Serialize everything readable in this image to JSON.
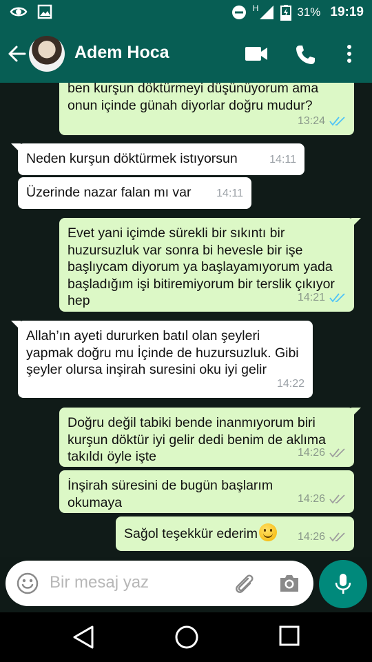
{
  "status_bar": {
    "network": "H",
    "battery": "31%",
    "time": "19:19",
    "icons": [
      "eye-icon",
      "image-icon",
      "do-not-disturb-icon",
      "signal-icon",
      "battery-icon"
    ]
  },
  "header": {
    "contact_name": "Adem Hoca",
    "icons": [
      "back-arrow-icon",
      "video-call-icon",
      "phone-icon",
      "more-vert-icon"
    ]
  },
  "messages": [
    {
      "dir": "out",
      "text": "ben kurşun döktürmeyi düşünüyorum ama onun içinde günah diyorlar doğru mudur?",
      "time": "13:24",
      "read": true
    },
    {
      "dir": "in",
      "text": "Neden kurşun döktürmek istıyorsun",
      "time": "14:11"
    },
    {
      "dir": "in",
      "text": "Üzerinde nazar falan mı var",
      "time": "14:11"
    },
    {
      "dir": "out",
      "text": "Evet yani içimde sürekli bir sıkıntı bir huzursuzluk var sonra bi hevesle bir işe başlıycam diyorum ya başlayamıyorum yada başladığım işi bitiremiyorum bir terslik çıkıyor hep",
      "time": "14:21",
      "read": true
    },
    {
      "dir": "in",
      "text": "Allah’ın ayeti dururken batıl olan şeyleri yapmak doğru mu İçinde  de huzursuzluk. Gibi şeyler olursa inşirah suresini oku iyi gelir",
      "time": "14:22"
    },
    {
      "dir": "out",
      "text": "Doğru değil tabiki bende inanmıyorum biri kurşun döktür iyi gelir dedi benim de aklıma takıldı öyle işte",
      "time": "14:26",
      "read": false
    },
    {
      "dir": "out",
      "text": "İnşirah süresini de bugün başlarım okumaya",
      "time": "14:26",
      "read": false
    },
    {
      "dir": "out",
      "text": "Sağol teşekkür ederim",
      "time": "14:26",
      "read": false,
      "emoji": "smiling-face-emoji"
    }
  ],
  "input": {
    "placeholder": "Bir mesaj yaz",
    "icons": [
      "emoji-icon",
      "attach-icon",
      "camera-icon",
      "mic-icon"
    ]
  },
  "colors": {
    "header": "#075e54",
    "outgoing_bubble": "#dcf8c6",
    "incoming_bubble": "#ffffff",
    "read_ticks": "#4fc3f7",
    "unread_ticks": "#9e9e9e",
    "fab": "#00897b"
  },
  "nav": {
    "icons": [
      "back-triangle-icon",
      "home-circle-icon",
      "recents-square-icon"
    ]
  }
}
